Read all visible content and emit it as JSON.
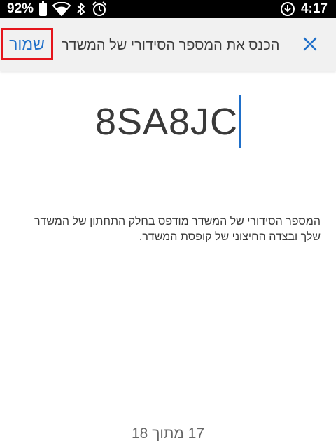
{
  "status_bar": {
    "battery_percent": "92%",
    "time": "4:17",
    "icons": [
      "battery-icon",
      "wifi-icon",
      "bluetooth-icon",
      "alarm-icon",
      "data-saver-icon"
    ]
  },
  "toolbar": {
    "save_label": "שמור",
    "title": "הכנס את המספר הסידורי של המשדר",
    "close_icon": "close-icon"
  },
  "serial_field": {
    "value": "8SA8JC"
  },
  "help": {
    "text": "המספר הסידורי של המשדר מודפס בחלק התחתון של המשדר שלך ובצדה החיצוני של קופסת המשדר."
  },
  "pager": {
    "label": "17 מתוך 18"
  },
  "colors": {
    "accent": "#1f6fc9",
    "highlight_border": "#e5151c",
    "toolbar_bg": "#f1f1f1",
    "status_bar_bg": "#000000"
  }
}
